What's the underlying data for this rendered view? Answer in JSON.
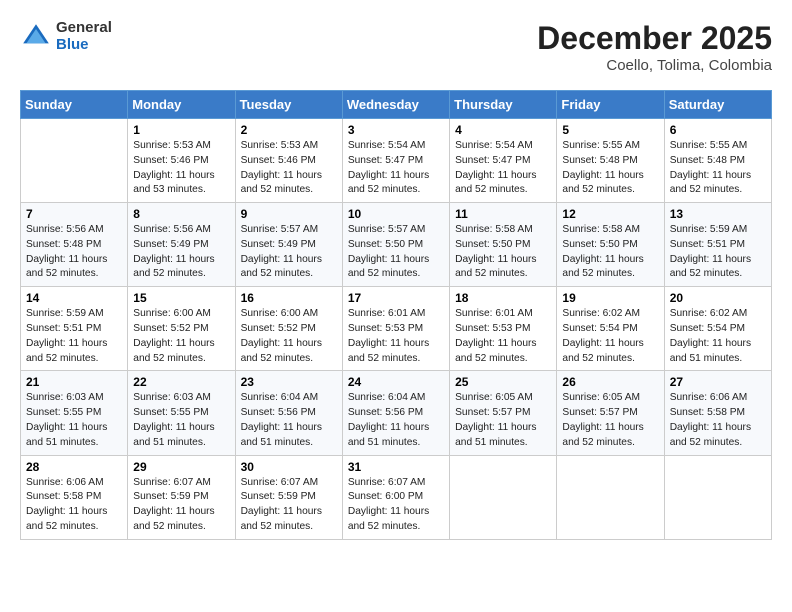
{
  "logo": {
    "general": "General",
    "blue": "Blue"
  },
  "title": "December 2025",
  "subtitle": "Coello, Tolima, Colombia",
  "days_of_week": [
    "Sunday",
    "Monday",
    "Tuesday",
    "Wednesday",
    "Thursday",
    "Friday",
    "Saturday"
  ],
  "weeks": [
    [
      {
        "day": "",
        "info": ""
      },
      {
        "day": "1",
        "info": "Sunrise: 5:53 AM\nSunset: 5:46 PM\nDaylight: 11 hours\nand 53 minutes."
      },
      {
        "day": "2",
        "info": "Sunrise: 5:53 AM\nSunset: 5:46 PM\nDaylight: 11 hours\nand 52 minutes."
      },
      {
        "day": "3",
        "info": "Sunrise: 5:54 AM\nSunset: 5:47 PM\nDaylight: 11 hours\nand 52 minutes."
      },
      {
        "day": "4",
        "info": "Sunrise: 5:54 AM\nSunset: 5:47 PM\nDaylight: 11 hours\nand 52 minutes."
      },
      {
        "day": "5",
        "info": "Sunrise: 5:55 AM\nSunset: 5:48 PM\nDaylight: 11 hours\nand 52 minutes."
      },
      {
        "day": "6",
        "info": "Sunrise: 5:55 AM\nSunset: 5:48 PM\nDaylight: 11 hours\nand 52 minutes."
      }
    ],
    [
      {
        "day": "7",
        "info": "Sunrise: 5:56 AM\nSunset: 5:48 PM\nDaylight: 11 hours\nand 52 minutes."
      },
      {
        "day": "8",
        "info": "Sunrise: 5:56 AM\nSunset: 5:49 PM\nDaylight: 11 hours\nand 52 minutes."
      },
      {
        "day": "9",
        "info": "Sunrise: 5:57 AM\nSunset: 5:49 PM\nDaylight: 11 hours\nand 52 minutes."
      },
      {
        "day": "10",
        "info": "Sunrise: 5:57 AM\nSunset: 5:50 PM\nDaylight: 11 hours\nand 52 minutes."
      },
      {
        "day": "11",
        "info": "Sunrise: 5:58 AM\nSunset: 5:50 PM\nDaylight: 11 hours\nand 52 minutes."
      },
      {
        "day": "12",
        "info": "Sunrise: 5:58 AM\nSunset: 5:50 PM\nDaylight: 11 hours\nand 52 minutes."
      },
      {
        "day": "13",
        "info": "Sunrise: 5:59 AM\nSunset: 5:51 PM\nDaylight: 11 hours\nand 52 minutes."
      }
    ],
    [
      {
        "day": "14",
        "info": "Sunrise: 5:59 AM\nSunset: 5:51 PM\nDaylight: 11 hours\nand 52 minutes."
      },
      {
        "day": "15",
        "info": "Sunrise: 6:00 AM\nSunset: 5:52 PM\nDaylight: 11 hours\nand 52 minutes."
      },
      {
        "day": "16",
        "info": "Sunrise: 6:00 AM\nSunset: 5:52 PM\nDaylight: 11 hours\nand 52 minutes."
      },
      {
        "day": "17",
        "info": "Sunrise: 6:01 AM\nSunset: 5:53 PM\nDaylight: 11 hours\nand 52 minutes."
      },
      {
        "day": "18",
        "info": "Sunrise: 6:01 AM\nSunset: 5:53 PM\nDaylight: 11 hours\nand 52 minutes."
      },
      {
        "day": "19",
        "info": "Sunrise: 6:02 AM\nSunset: 5:54 PM\nDaylight: 11 hours\nand 52 minutes."
      },
      {
        "day": "20",
        "info": "Sunrise: 6:02 AM\nSunset: 5:54 PM\nDaylight: 11 hours\nand 51 minutes."
      }
    ],
    [
      {
        "day": "21",
        "info": "Sunrise: 6:03 AM\nSunset: 5:55 PM\nDaylight: 11 hours\nand 51 minutes."
      },
      {
        "day": "22",
        "info": "Sunrise: 6:03 AM\nSunset: 5:55 PM\nDaylight: 11 hours\nand 51 minutes."
      },
      {
        "day": "23",
        "info": "Sunrise: 6:04 AM\nSunset: 5:56 PM\nDaylight: 11 hours\nand 51 minutes."
      },
      {
        "day": "24",
        "info": "Sunrise: 6:04 AM\nSunset: 5:56 PM\nDaylight: 11 hours\nand 51 minutes."
      },
      {
        "day": "25",
        "info": "Sunrise: 6:05 AM\nSunset: 5:57 PM\nDaylight: 11 hours\nand 51 minutes."
      },
      {
        "day": "26",
        "info": "Sunrise: 6:05 AM\nSunset: 5:57 PM\nDaylight: 11 hours\nand 52 minutes."
      },
      {
        "day": "27",
        "info": "Sunrise: 6:06 AM\nSunset: 5:58 PM\nDaylight: 11 hours\nand 52 minutes."
      }
    ],
    [
      {
        "day": "28",
        "info": "Sunrise: 6:06 AM\nSunset: 5:58 PM\nDaylight: 11 hours\nand 52 minutes."
      },
      {
        "day": "29",
        "info": "Sunrise: 6:07 AM\nSunset: 5:59 PM\nDaylight: 11 hours\nand 52 minutes."
      },
      {
        "day": "30",
        "info": "Sunrise: 6:07 AM\nSunset: 5:59 PM\nDaylight: 11 hours\nand 52 minutes."
      },
      {
        "day": "31",
        "info": "Sunrise: 6:07 AM\nSunset: 6:00 PM\nDaylight: 11 hours\nand 52 minutes."
      },
      {
        "day": "",
        "info": ""
      },
      {
        "day": "",
        "info": ""
      },
      {
        "day": "",
        "info": ""
      }
    ]
  ]
}
